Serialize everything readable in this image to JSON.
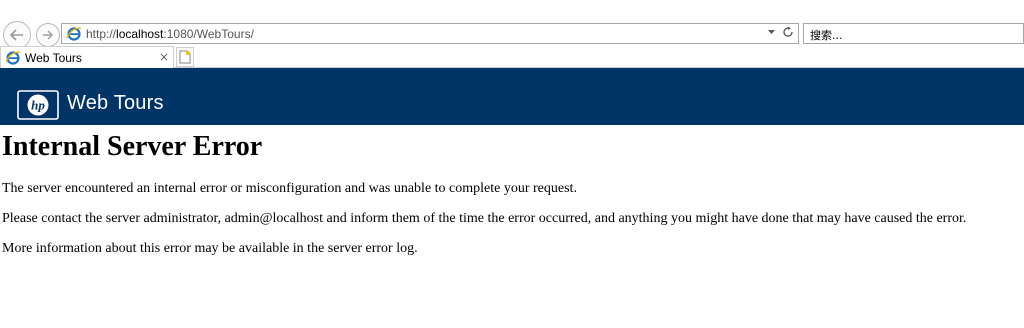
{
  "browser": {
    "address_url_prefix": "http://",
    "address_url_host": "localhost",
    "address_url_path": ":1080/WebTours/",
    "search_placeholder": "搜索...",
    "tab_title": "Web Tours",
    "tab_close": "×"
  },
  "page": {
    "banner_title": "Web Tours",
    "logo_text": "hp",
    "error_heading": "Internal Server Error",
    "paragraphs": [
      "The server encountered an internal error or misconfiguration and was unable to complete your request.",
      "Please contact the server administrator, admin@localhost and inform them of the time the error occurred, and anything you might have done that may have caused the error.",
      "More information about this error may be available in the server error log."
    ],
    "banner_color": "#003366"
  },
  "icons": [
    "back-arrow-icon",
    "forward-arrow-icon",
    "ie-icon",
    "dropdown-icon",
    "refresh-icon",
    "new-tab-icon",
    "hp-logo-icon"
  ]
}
